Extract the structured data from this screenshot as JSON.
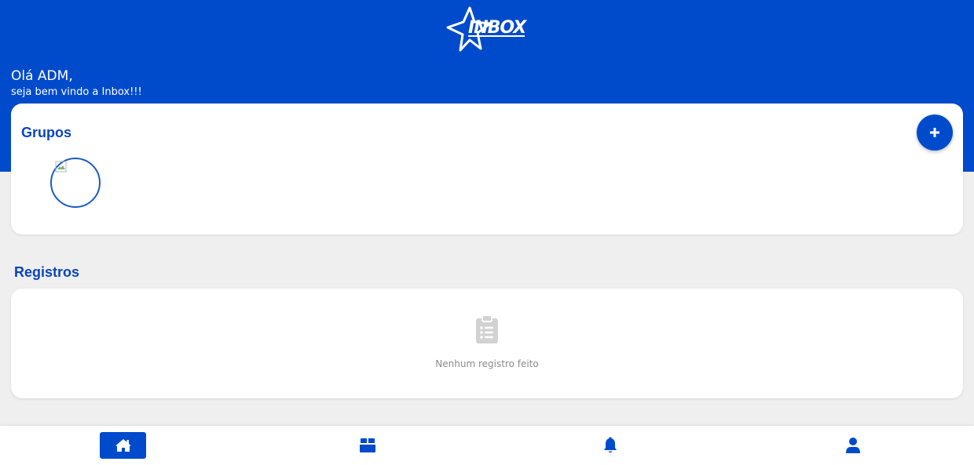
{
  "app": {
    "logo_text": "INBOX",
    "brand_color": "#004bcc"
  },
  "greeting": {
    "title": "Olá ADM,",
    "subtitle": "seja bem vindo a Inbox!!!"
  },
  "groups": {
    "title": "Grupos",
    "add_icon": "plus-icon",
    "items": [
      {
        "image_icon": "broken-image-icon"
      }
    ]
  },
  "records": {
    "title": "Registros",
    "empty_icon": "clipboard-list-icon",
    "empty_text": "Nenhum registro feito"
  },
  "bottom_nav": {
    "active": "home",
    "items": [
      {
        "key": "home",
        "icon": "home-icon"
      },
      {
        "key": "boxes",
        "icon": "box-icon"
      },
      {
        "key": "notifications",
        "icon": "bell-icon"
      },
      {
        "key": "profile",
        "icon": "user-icon"
      }
    ]
  }
}
